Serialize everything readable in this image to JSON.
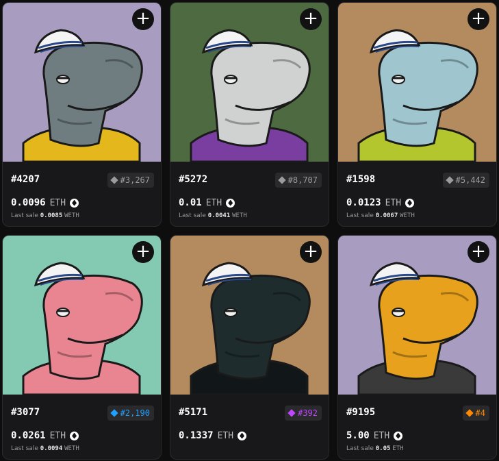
{
  "colors": {
    "card_bg": "#18181a",
    "rank_common": "#9b9b9b",
    "rank_rare": "#1fa1ff",
    "rank_epic": "#c046ff",
    "rank_legendary": "#ff8a00"
  },
  "cards": [
    {
      "name": "#4207",
      "rank": "#3,267",
      "rank_tier": "common",
      "price": "0.0096",
      "unit": "ETH",
      "last_sale_label": "Last sale",
      "last_sale_value": "0.0085",
      "last_sale_unit": "WETH",
      "bg": "#a89cc0",
      "skin": "#6f7d80",
      "shirt": "#e4b81c"
    },
    {
      "name": "#5272",
      "rank": "#8,707",
      "rank_tier": "common",
      "price": "0.01",
      "unit": "ETH",
      "last_sale_label": "Last sale",
      "last_sale_value": "0.0041",
      "last_sale_unit": "WETH",
      "bg": "#4d6a40",
      "skin": "#cfd2d1",
      "shirt": "#7a3da0"
    },
    {
      "name": "#1598",
      "rank": "#5,442",
      "rank_tier": "common",
      "price": "0.0123",
      "unit": "ETH",
      "last_sale_label": "Last sale",
      "last_sale_value": "0.0067",
      "last_sale_unit": "WETH",
      "bg": "#b48b5e",
      "skin": "#9fc6cf",
      "shirt": "#b3c62e"
    },
    {
      "name": "#3077",
      "rank": "#2,190",
      "rank_tier": "rare",
      "price": "0.0261",
      "unit": "ETH",
      "last_sale_label": "Last sale",
      "last_sale_value": "0.0094",
      "last_sale_unit": "WETH",
      "bg": "#84c9b1",
      "skin": "#e98590",
      "shirt": "#e98590"
    },
    {
      "name": "#5171",
      "rank": "#392",
      "rank_tier": "epic",
      "price": "0.1337",
      "unit": "ETH",
      "last_sale_label": "",
      "last_sale_value": "",
      "last_sale_unit": "",
      "bg": "#b48b5e",
      "skin": "#1e2c2e",
      "shirt": "#111618"
    },
    {
      "name": "#9195",
      "rank": "#4",
      "rank_tier": "legendary",
      "price": "5.00",
      "unit": "ETH",
      "last_sale_label": "Last sale",
      "last_sale_value": "0.05",
      "last_sale_unit": "ETH",
      "bg": "#a89cc0",
      "skin": "#e8a11c",
      "shirt": "#3a3a3a"
    }
  ]
}
